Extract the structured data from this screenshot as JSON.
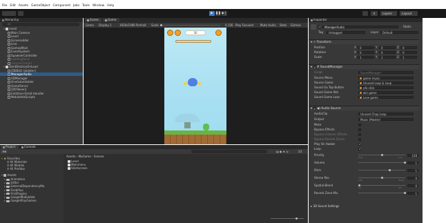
{
  "menu": [
    "File",
    "Edit",
    "Assets",
    "GameObject",
    "Component",
    "Jobs",
    "Tools",
    "Window",
    "Help"
  ],
  "toolbar": {
    "layers": "Layers",
    "layout": "Layout",
    "account_icon": "cloud-icon"
  },
  "hierarchy": {
    "tab": "Hierarchy",
    "search_placeholder": "All",
    "items": [
      {
        "label": "Level",
        "indent": 1,
        "type": "scene",
        "state": "normal"
      },
      {
        "label": "Main Camera",
        "indent": 3,
        "type": "go",
        "state": "normal"
      },
      {
        "label": "Level",
        "indent": 3,
        "type": "go",
        "state": "normal"
      },
      {
        "label": "Screenadder",
        "indent": 3,
        "type": "go",
        "state": "normal"
      },
      {
        "label": "Line",
        "indent": 3,
        "type": "go",
        "state": "normal"
      },
      {
        "label": "GameaMain",
        "indent": 3,
        "type": "go",
        "state": "normal"
      },
      {
        "label": "EventSystem",
        "indent": 3,
        "type": "go",
        "state": "normal"
      },
      {
        "label": "SpawnerController",
        "indent": 3,
        "type": "go",
        "state": "normal"
      },
      {
        "label": "LoadingPanel",
        "indent": 3,
        "type": "go",
        "state": "dim"
      },
      {
        "label": "CanvasCharter",
        "indent": 3,
        "type": "go",
        "state": "dim"
      },
      {
        "label": "DontDestroyOnLoad",
        "indent": 1,
        "type": "scene",
        "state": "normal"
      },
      {
        "label": "[DEBUG Updater]",
        "indent": 3,
        "type": "go",
        "state": "normal"
      },
      {
        "label": "ManagerAudio",
        "indent": 3,
        "type": "go",
        "state": "selected"
      },
      {
        "label": "ADManager",
        "indent": 3,
        "type": "go",
        "state": "normal"
      },
      {
        "label": "OnelistonHolder",
        "indent": 3,
        "type": "go",
        "state": "normal"
      },
      {
        "label": "GameSence",
        "indent": 3,
        "type": "go",
        "state": "normal"
      },
      {
        "label": "[DOTween]",
        "indent": 3,
        "type": "go",
        "state": "normal"
      },
      {
        "label": "Enlitition-Dreid Handler",
        "indent": 3,
        "type": "go",
        "state": "normal"
      },
      {
        "label": "MobileAdsScripts",
        "indent": 3,
        "type": "go",
        "state": "normal"
      }
    ]
  },
  "scene_view": {
    "tabs": [
      "Scene",
      "Game"
    ],
    "game_bar": {
      "display": "Game",
      "display_num": "Display 1",
      "resolution": "1920x1080 Portrait",
      "scale": "Scale",
      "scale_val": "0.156",
      "play_focused": "Play Focused",
      "mute": "Mute Audio",
      "stats": "Stats",
      "gizmos": "Gizmos"
    },
    "game_hud": {
      "score": "30"
    }
  },
  "project": {
    "tabs": [
      "Project",
      "Console"
    ],
    "favorites": {
      "label": "Favorites",
      "items": [
        "All Materials",
        "All Models",
        "All Prefabs"
      ]
    },
    "assets": {
      "label": "Assets",
      "items": [
        "Animation",
        "Editor",
        "ExternalDependencyMa",
        "FirebPlus",
        "FirstPlugins",
        "GoogleMobileAds",
        "GooglePlayGames"
      ]
    },
    "breadcrumb": [
      "Assets",
      "MyGame",
      "Scenes"
    ],
    "files": [
      "Level",
      "Mainmenu",
      "Startscreen"
    ],
    "count": "23"
  },
  "inspector": {
    "tab": "Inspector",
    "object_name": "ManagerAudio",
    "static_label": "Static",
    "tag_label": "Tag",
    "tag_value": "Untagged",
    "layer_label": "Layer",
    "layer_value": "Default",
    "transform": {
      "title": "Transform",
      "rows": [
        {
          "label": "Position",
          "x": "0",
          "y": "0",
          "z": "0"
        },
        {
          "label": "Rotation",
          "x": "0",
          "y": "0",
          "z": "0"
        },
        {
          "label": "Scale",
          "x": "1",
          "y": "1",
          "z": "1"
        }
      ]
    },
    "sound_manager": {
      "title": "SoundManager",
      "script_label": "Script",
      "script_value": "SoundManager",
      "rows": [
        {
          "label": "Source Menu",
          "value": "game music"
        },
        {
          "label": "Source Game",
          "value": "Unused Loop & Loop"
        },
        {
          "label": "Sound Go Top Button",
          "value": "ufo click"
        },
        {
          "label": "Sound Game Win",
          "value": "win game"
        },
        {
          "label": "Sound Game Lose",
          "value": "Lose game"
        }
      ]
    },
    "audio_source": {
      "title": "Audio Source",
      "clip_label": "AudioClip",
      "clip_value": "Unused Chap Loop",
      "output_label": "Output",
      "output_value": "Music (Master)",
      "checks": [
        {
          "label": "Mute",
          "checked": false
        },
        {
          "label": "Bypass Effects",
          "checked": false
        },
        {
          "label": "Bypass Listener Effects",
          "checked": false
        },
        {
          "label": "Bypass Reverb Zones",
          "checked": false
        },
        {
          "label": "Play On Awake",
          "checked": true
        },
        {
          "label": "Loop",
          "checked": true
        }
      ],
      "sliders": [
        {
          "label": "Priority",
          "value": "128",
          "low": "High",
          "high": "Low",
          "fraction": 0.5
        },
        {
          "label": "Volume",
          "value": "1",
          "fraction": 1.0
        },
        {
          "label": "Pitch",
          "value": "1",
          "fraction": 0.66
        },
        {
          "label": "Stereo Pan",
          "value": "0",
          "low": "Left",
          "high": "Right",
          "fraction": 0.5
        },
        {
          "label": "Spatial Blend",
          "value": "0",
          "low": "2D",
          "high": "3D",
          "fraction": 0.0
        },
        {
          "label": "Reverb Zone Mix",
          "value": "1",
          "fraction": 1.0
        }
      ],
      "settings_3d": "3D Sound Settings"
    }
  }
}
